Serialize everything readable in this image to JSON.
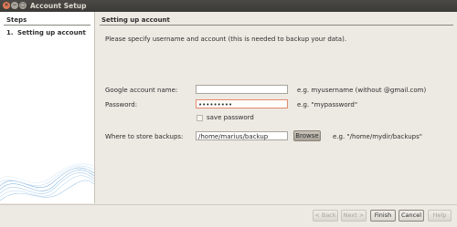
{
  "window": {
    "title": "Account Setup",
    "close_glyph": "×",
    "min_glyph": "−",
    "max_glyph": "□"
  },
  "sidebar": {
    "heading": "Steps",
    "items": [
      {
        "num": "1.",
        "label": "Setting up account"
      }
    ]
  },
  "main": {
    "heading": "Setting up account",
    "intro": "Please specify username and account (this is needed to backup your data).",
    "account": {
      "label": "Google account name:",
      "value": "",
      "hint": "e.g. myusername (without @gmail.com)"
    },
    "password": {
      "label": "Password:",
      "value": "•••••••••",
      "hint": "e.g. \"mypassword\""
    },
    "save_password": {
      "label": "save password",
      "checked": false
    },
    "backup": {
      "label": "Where to store backups:",
      "value": "/home/marius/backup",
      "browse": "Browse",
      "hint": "e.g. \"/home/mydir/backups\""
    }
  },
  "buttons": {
    "back": "< Back",
    "next": "Next >",
    "finish": "Finish",
    "cancel": "Cancel",
    "help": "Help"
  },
  "colors": {
    "titlebar": "#3b3a37",
    "window_bg": "#ede9e3",
    "focus_border": "#e38a6e",
    "wave": "#6fa8d8"
  }
}
